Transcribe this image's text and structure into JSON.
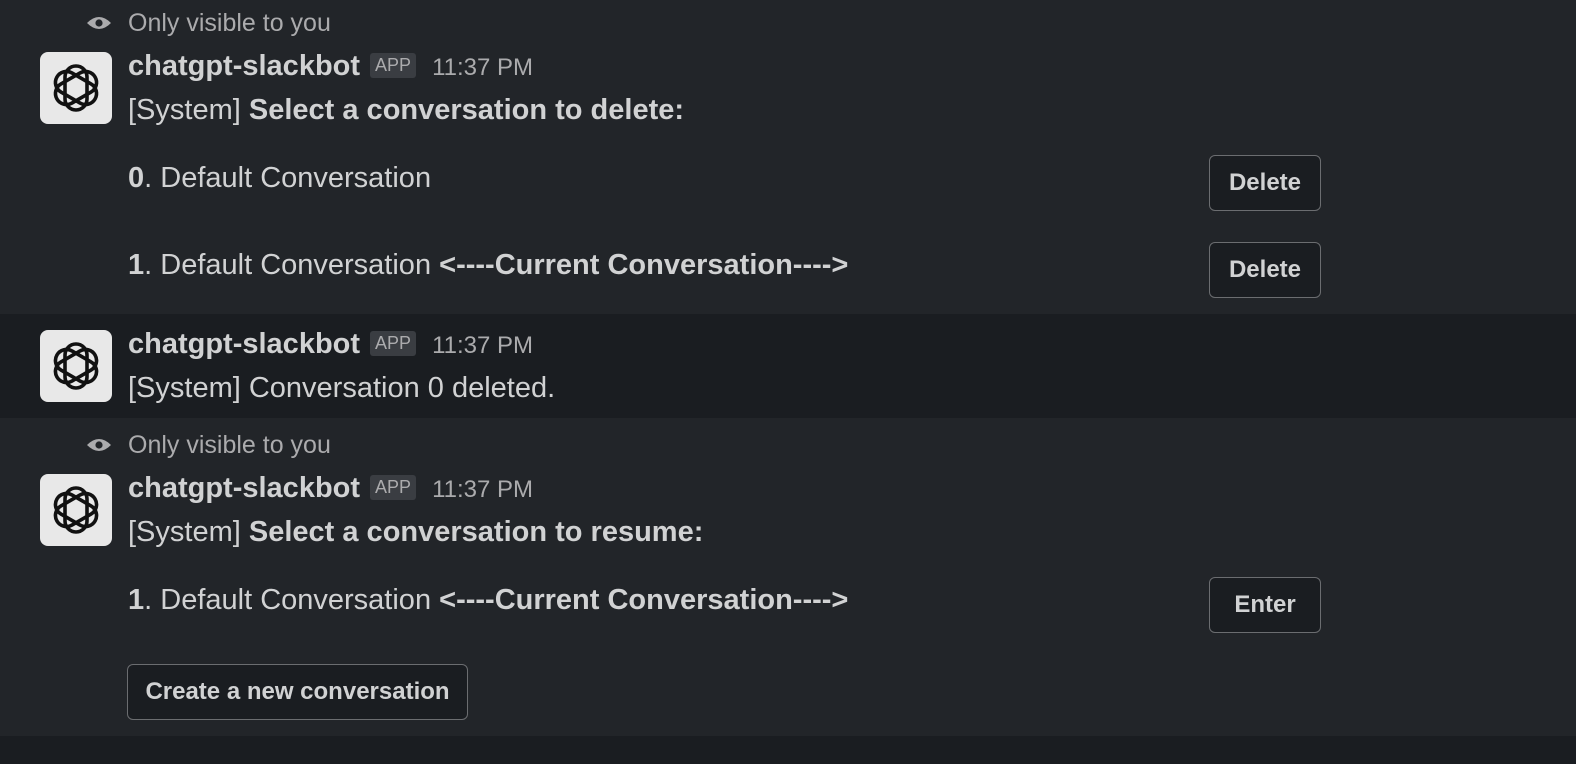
{
  "colors": {
    "background": "#1a1d21",
    "message_bg": "#222529",
    "text": "#d1d2d3",
    "muted": "#ababad"
  },
  "messages": [
    {
      "visibility": "Only visible to you",
      "bot_name": "chatgpt-slackbot",
      "badge": "APP",
      "time": "11:37 PM",
      "system_prefix": "[System]",
      "prompt": "Select a conversation to delete:",
      "items": [
        {
          "index": "0",
          "title": ". Default Conversation",
          "current": "",
          "button": "Delete"
        },
        {
          "index": "1",
          "title": ". Default Conversation",
          "current": "<----Current Conversation---->",
          "button": "Delete"
        }
      ]
    },
    {
      "bot_name": "chatgpt-slackbot",
      "badge": "APP",
      "time": "11:37 PM",
      "text": "[System] Conversation 0 deleted."
    },
    {
      "visibility": "Only visible to you",
      "bot_name": "chatgpt-slackbot",
      "badge": "APP",
      "time": "11:37 PM",
      "system_prefix": "[System]",
      "prompt": "Select a conversation to resume:",
      "items": [
        {
          "index": "1",
          "title": ". Default Conversation",
          "current": "<----Current Conversation---->",
          "button": "Enter"
        }
      ],
      "create_button": "Create a new conversation"
    }
  ]
}
